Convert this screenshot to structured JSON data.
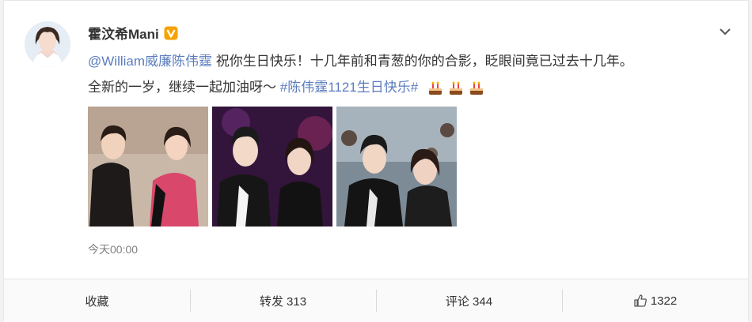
{
  "post": {
    "username": "霍汶希Mani",
    "verified_icon": "verified-v-icon",
    "more_icon": "chevron-down-icon",
    "mention": "@William威廉陈伟霆",
    "text_part1": " 祝你生日快乐！十几年前和青葱的你的合影，眨眼间竟已过去十几年。",
    "text_part2": "全新的一岁，继续一起加油呀～ ",
    "hashtag": "#陈伟霆1121生日快乐#",
    "emoji_count": 3,
    "emoji_icon": "birthday-cake-icon",
    "timestamp": "今天00:00"
  },
  "actions": {
    "favorite": "收藏",
    "repost": "转发 313",
    "comment": "评论 344",
    "like": "1322",
    "like_icon": "thumbs-up-icon"
  },
  "colors": {
    "accent_link": "#eb7350",
    "mention_link": "#5b7cbf",
    "verified_badge": "#f7a200"
  }
}
